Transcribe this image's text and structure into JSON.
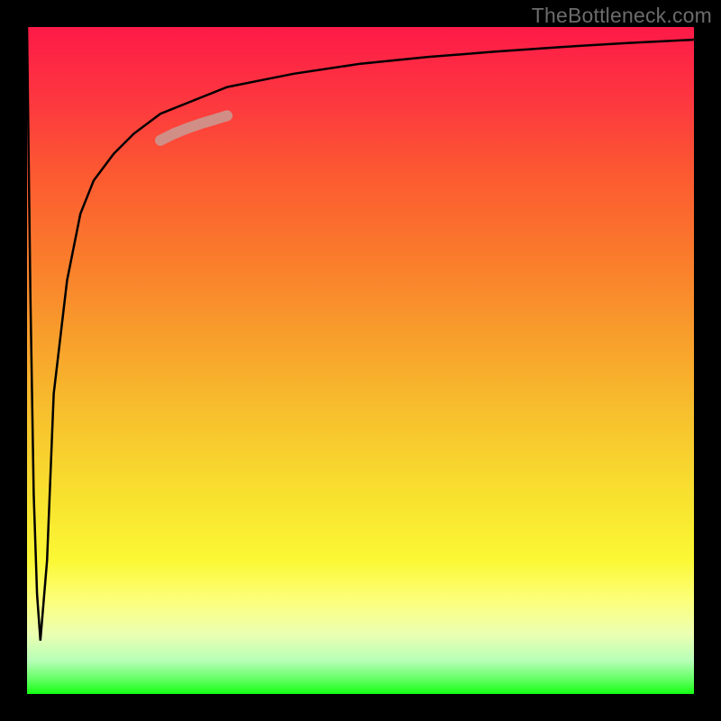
{
  "watermark": "TheBottleneck.com",
  "chart_data": {
    "type": "line",
    "title": "",
    "xlabel": "",
    "ylabel": "",
    "xlim": [
      0,
      100
    ],
    "ylim": [
      0,
      100
    ],
    "grid": false,
    "legend": false,
    "background_gradient": {
      "direction": "vertical",
      "stops": [
        {
          "pos": 0,
          "color": "#fd1a48"
        },
        {
          "pos": 20,
          "color": "#fc5931"
        },
        {
          "pos": 40,
          "color": "#f89d2c"
        },
        {
          "pos": 60,
          "color": "#f7c02d"
        },
        {
          "pos": 80,
          "color": "#fbf835"
        },
        {
          "pos": 95,
          "color": "#b7ffb7"
        },
        {
          "pos": 100,
          "color": "#14ff14"
        }
      ]
    },
    "series": [
      {
        "name": "main-curve",
        "color": "#000000",
        "stroke_width": 2.5,
        "x": [
          0,
          0.5,
          1,
          1.5,
          2,
          3,
          4,
          6,
          8,
          10,
          13,
          16,
          20,
          25,
          30,
          35,
          40,
          50,
          60,
          70,
          80,
          90,
          100
        ],
        "values": [
          100,
          60,
          30,
          15,
          8,
          20,
          45,
          62,
          72,
          77,
          81,
          84,
          87,
          89,
          91,
          92,
          93,
          94.5,
          95.5,
          96.3,
          97,
          97.6,
          98.1
        ]
      },
      {
        "name": "highlight-segment",
        "color": "#d08e86",
        "stroke_width": 12,
        "linecap": "round",
        "x": [
          20,
          22,
          24,
          26,
          28,
          30
        ],
        "values": [
          83,
          84,
          84.8,
          85.5,
          86.1,
          86.7
        ]
      }
    ],
    "annotations": []
  }
}
